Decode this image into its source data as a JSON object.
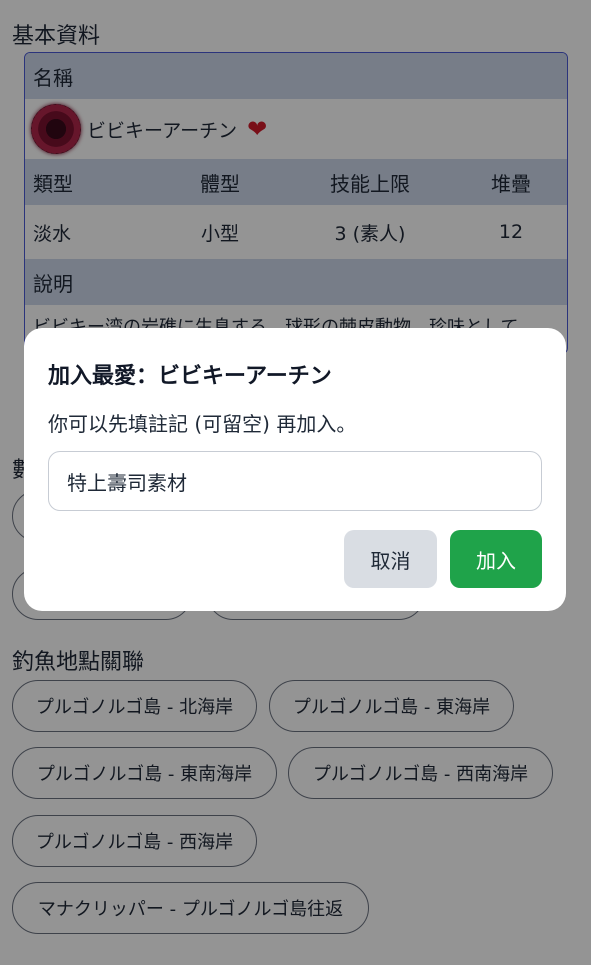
{
  "basic_info": {
    "section_title": "基本資料",
    "name_header": "名稱",
    "fish_name": "ビビキーアーチン",
    "heart_icon": "heart-icon",
    "columns": [
      "類型",
      "體型",
      "技能上限",
      "堆疊"
    ],
    "values": [
      "淡水",
      "小型",
      "3 (素人)",
      "12"
    ],
    "desc_header": "說明",
    "desc_text": "ビビキー湾の岩礁に生息する、球形の棘皮動物。珍味として"
  },
  "hidden_section_first_char": "數",
  "fishing_spots": {
    "section_title": "釣魚地點關聯",
    "items": [
      "プルゴノルゴ島 - 北海岸",
      "プルゴノルゴ島 - 東海岸",
      "プルゴノルゴ島 - 東南海岸",
      "プルゴノルゴ島 - 西南海岸",
      "プルゴノルゴ島 - 西海岸",
      "マナクリッパー - プルゴノルゴ島往返"
    ]
  },
  "dialog": {
    "title": "加入最愛：ビビキーアーチン",
    "subtitle": "你可以先填註記 (可留空) 再加入。",
    "note_value": "特上壽司素材",
    "cancel_label": "取消",
    "add_label": "加入"
  },
  "colors": {
    "header_bg": "#cdd8ea",
    "border": "#4b5bd6",
    "add_button": "#1fa34a",
    "cancel_button": "#d9dde3"
  }
}
